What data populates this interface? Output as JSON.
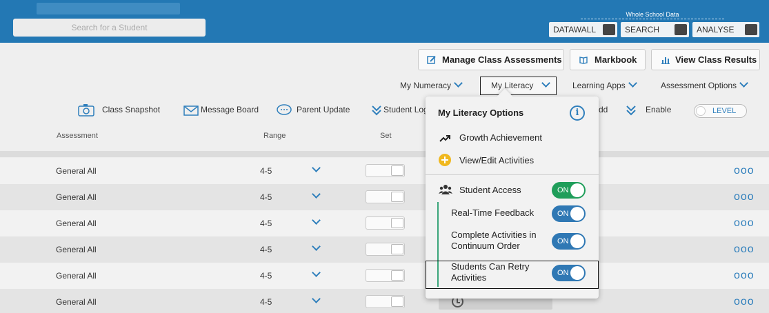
{
  "header": {
    "search_placeholder": "Search for a Student",
    "whole_school_label": "Whole School Data",
    "buttons": [
      "DATAWALL",
      "SEARCH",
      "ANALYSE"
    ]
  },
  "toolbar": {
    "manage": "Manage Class Assessments",
    "markbook": "Markbook",
    "results": "View Class Results"
  },
  "menus": {
    "numeracy": "My Numeracy",
    "literacy": "My Literacy",
    "apps": "Learning Apps",
    "options": "Assessment Options"
  },
  "actions": {
    "snapshot": "Class Snapshot",
    "message": "Message Board",
    "parent": "Parent Update",
    "student_log": "Student Log",
    "add_suffix": "dd",
    "enable": "Enable",
    "level": "LEVEL"
  },
  "table": {
    "headers": {
      "assessment": "Assessment",
      "range": "Range",
      "set": "Set"
    },
    "rows": [
      {
        "assessment": "General All",
        "range": "4-5"
      },
      {
        "assessment": "General All",
        "range": "4-5"
      },
      {
        "assessment": "General All",
        "range": "4-5"
      },
      {
        "assessment": "General All",
        "range": "4-5"
      },
      {
        "assessment": "General All",
        "range": "4-5"
      },
      {
        "assessment": "General All",
        "range": "4-5"
      }
    ],
    "more_glyph": "ooo"
  },
  "dropdown": {
    "title": "My Literacy Options",
    "info_glyph": "i",
    "growth": "Growth Achievement",
    "view_edit": "View/Edit Activities",
    "student_access": "Student Access",
    "realtime": "Real-Time Feedback",
    "complete_line1": "Complete Activities in",
    "complete_line2": "Continuum Order",
    "retry_line1": "Students Can Retry",
    "retry_line2": "Activities",
    "on_label": "ON"
  },
  "colors": {
    "header_blue": "#2378b4",
    "accent_blue": "#2f7fbc",
    "toggle_green": "#1f9e5a"
  }
}
